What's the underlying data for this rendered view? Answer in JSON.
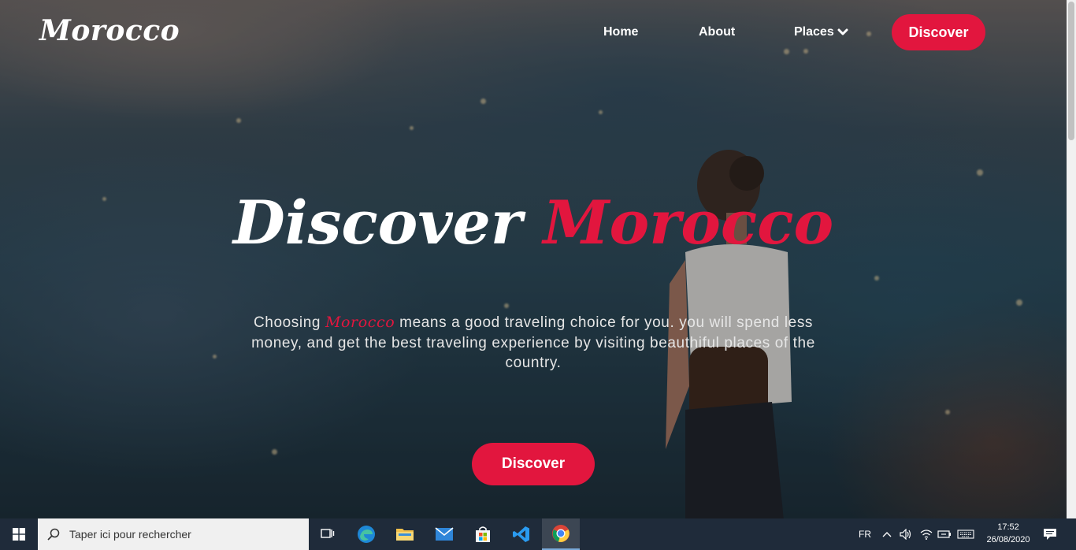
{
  "nav": {
    "brand": "Morocco",
    "home": "Home",
    "about": "About",
    "places": "Places",
    "discover_button": "Discover"
  },
  "hero": {
    "title_main": "Discover",
    "title_accent": "Morocco",
    "text_before": "Choosing",
    "text_accent": "Morocco",
    "text_after": "means a good traveling choice for you. you will spend less money, and get the best traveling experience by visiting beauthiful places of the country.",
    "cta": "Discover"
  },
  "taskbar": {
    "search_placeholder": "Taper ici pour rechercher",
    "language": "FR",
    "time": "17:52",
    "date": "26/08/2020"
  },
  "colors": {
    "accent": "#e2163e",
    "taskbar": "#1f2b3a"
  }
}
